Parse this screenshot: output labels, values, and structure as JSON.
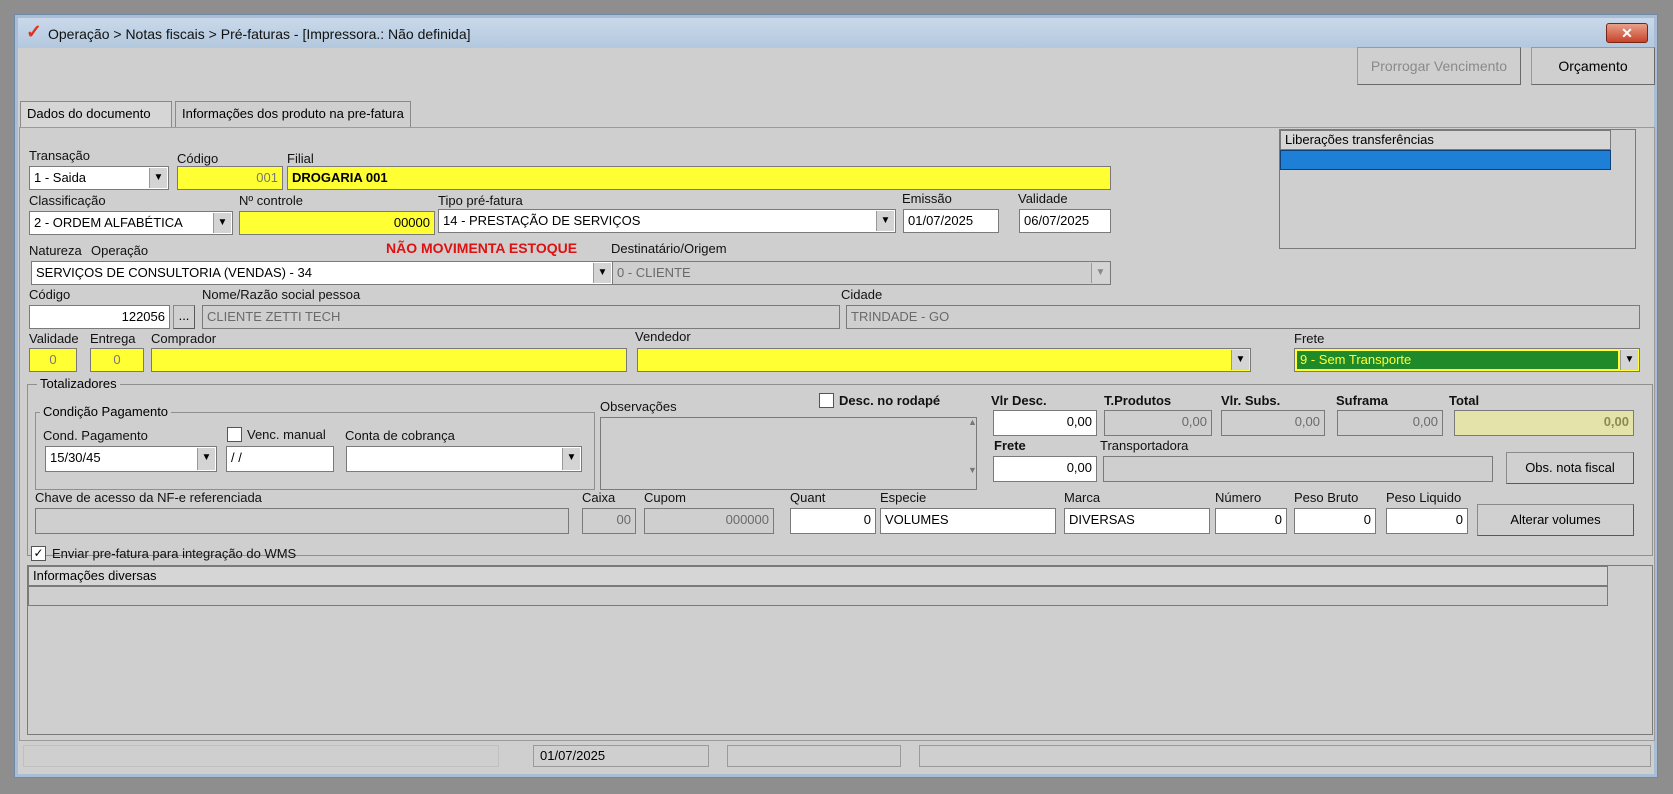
{
  "window": {
    "title": "Operação > Notas fiscais > Pré-faturas - [Impressora.: Não definida]",
    "close_label": "✕"
  },
  "toolbar": {
    "prorrogar_label": "Prorrogar Vencimento",
    "orcamento_label": "Orçamento"
  },
  "tabs": [
    {
      "label": "Dados do documento"
    },
    {
      "label": "Informações dos produto na pre-fatura"
    }
  ],
  "form": {
    "transacao_label": "Transação",
    "transacao_value": "1 - Saida",
    "codigo_label": "Código",
    "codigo_value": "001",
    "filial_label": "Filial",
    "filial_value": "DROGARIA 001",
    "classificacao_label": "Classificação",
    "classificacao_value": "2 - ORDEM ALFABÉTICA",
    "controle_label": "Nº controle",
    "controle_value": "00000",
    "tipo_label": "Tipo pré-fatura",
    "tipo_value": "14 - PRESTAÇÃO DE SERVIÇOS",
    "emissao_label": "Emissão",
    "emissao_value": "01/07/2025",
    "validade_label": "Validade",
    "validade_value": "06/07/2025",
    "natureza_label": "Natureza",
    "operacao_label": "Operação",
    "nao_movimenta": "NÃO MOVIMENTA ESTOQUE",
    "natureza_value": "SERVIÇOS DE CONSULTORIA (VENDAS) - 34",
    "destinatario_label": "Destinatário/Origem",
    "destinatario_value": "0 - CLIENTE",
    "pessoa_codigo_label": "Código",
    "pessoa_codigo_value": "122056",
    "pessoa_lookup": "...",
    "nome_label": "Nome/Razão social pessoa",
    "nome_value": "CLIENTE ZETTI TECH",
    "cidade_label": "Cidade",
    "cidade_value": "TRINDADE - GO",
    "val_label": "Validade",
    "val_value": "0",
    "entrega_label": "Entrega",
    "entrega_value": "0",
    "comprador_label": "Comprador",
    "comprador_value": "",
    "vendedor_label": "Vendedor",
    "vendedor_value": "",
    "frete_label": "Frete",
    "frete_value": "9 - Sem Transporte"
  },
  "liberacoes": {
    "header": "Liberações transferências"
  },
  "totalizadores": {
    "legend": "Totalizadores",
    "cond_legend": "Condição Pagamento",
    "cond_label": "Cond. Pagamento",
    "cond_value": "15/30/45",
    "venc_label": "Venc. manual",
    "venc_value": "/ /",
    "conta_label": "Conta de cobrança",
    "conta_value": "",
    "obs_label": "Observações",
    "desc_rodape_label": "Desc. no rodapé",
    "vlr_desc_label": "Vlr Desc.",
    "vlr_desc_value": "0,00",
    "tprod_label": "T.Produtos",
    "tprod_value": "0,00",
    "vlrsubs_label": "Vlr. Subs.",
    "vlrsubs_value": "0,00",
    "suframa_label": "Suframa",
    "suframa_value": "0,00",
    "total_label": "Total",
    "total_value": "0,00",
    "frete_label": "Frete",
    "frete_value": "0,00",
    "transp_label": "Transportadora",
    "transp_value": "",
    "obs_nota_btn": "Obs. nota fiscal",
    "chave_label": "Chave de acesso da NF-e referenciada",
    "chave_value": "",
    "caixa_label": "Caixa",
    "caixa_value": "00",
    "cupom_label": "Cupom",
    "cupom_value": "000000",
    "quant_label": "Quant",
    "quant_value": "0",
    "especie_label": "Especie",
    "especie_value": "VOLUMES",
    "marca_label": "Marca",
    "marca_value": "DIVERSAS",
    "numero_label": "Número",
    "numero_value": "0",
    "pbruto_label": "Peso Bruto",
    "pbruto_value": "0",
    "pliq_label": "Peso Liquido",
    "pliq_value": "0",
    "alterar_btn": "Alterar volumes"
  },
  "wms": {
    "label": "Enviar pre-fatura para integração do WMS",
    "checked_mark": "✓"
  },
  "info": {
    "header": "Informações diversas"
  },
  "status": {
    "date": "01/07/2025"
  }
}
